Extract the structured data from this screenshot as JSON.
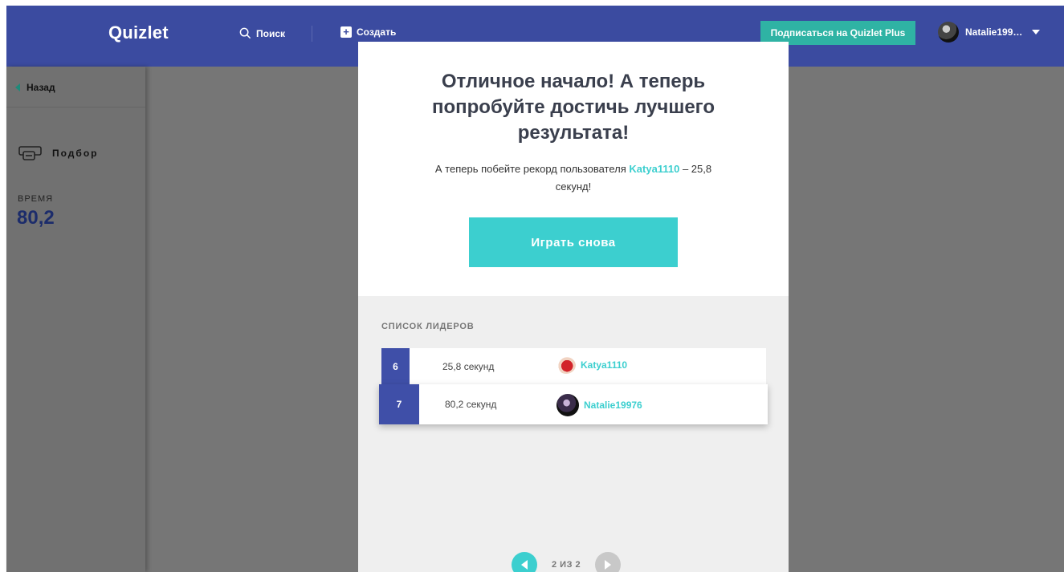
{
  "header": {
    "logo": "Quizlet",
    "search_label": "Поиск",
    "create_label": "Создать",
    "plus_button": "Подписаться на Quizlet Plus",
    "username": "Natalie199…"
  },
  "sidebar": {
    "back_label": "Назад",
    "mode_label": "Подбор",
    "time_label": "ВРЕМЯ",
    "time_value": "80,2"
  },
  "modal": {
    "title": "Отличное начало! А теперь попробуйте достичь лучшего результата!",
    "subtitle_prefix": "А теперь побейте рекорд пользователя",
    "record_user": "Katya1110",
    "subtitle_suffix": "– 25,8 секунд!",
    "play_again": "Играть снова"
  },
  "leaderboard": {
    "title": "СПИСОК ЛИДЕРОВ",
    "rows": [
      {
        "rank": "6",
        "score": "25,8 секунд",
        "player": "Katya1110"
      },
      {
        "rank": "7",
        "score": "80,2 секунд",
        "player": "Natalie19976"
      }
    ],
    "pager_text": "2 ИЗ 2"
  },
  "colors": {
    "header_bg": "#3b4ba0",
    "accent": "#3ccfcf",
    "plus_button": "#2fb3a4",
    "rank_bg": "#3f4fa8",
    "time_value": "#1c2c6b"
  }
}
